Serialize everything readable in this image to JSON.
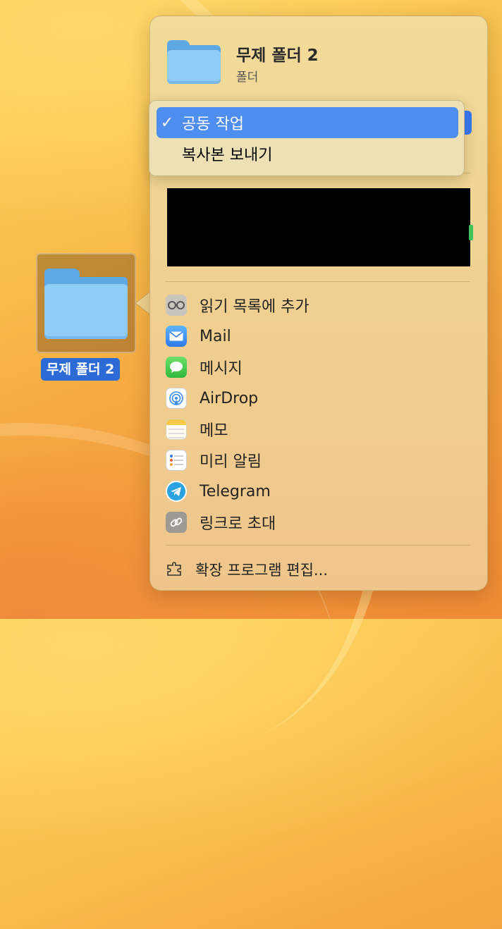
{
  "desktop": {
    "folder_name": "무제 폴더 2"
  },
  "share": {
    "title": "무제 폴더 2",
    "subtitle": "폴더",
    "dropdown": {
      "options": [
        {
          "label": "공동 작업",
          "selected": true,
          "check": "✓"
        },
        {
          "label": "복사본 보내기",
          "selected": false,
          "check": ""
        }
      ]
    },
    "items": [
      {
        "label": "읽기 목록에 추가",
        "icon": "reading-list-icon"
      },
      {
        "label": "Mail",
        "icon": "mail-icon"
      },
      {
        "label": "메시지",
        "icon": "messages-icon"
      },
      {
        "label": "AirDrop",
        "icon": "airdrop-icon"
      },
      {
        "label": "메모",
        "icon": "notes-icon"
      },
      {
        "label": "미리 알림",
        "icon": "reminders-icon"
      },
      {
        "label": "Telegram",
        "icon": "telegram-icon"
      },
      {
        "label": "링크로 초대",
        "icon": "link-icon"
      }
    ],
    "edit_extensions": "확장 프로그램 편집..."
  },
  "colors": {
    "accent": "#3478f6",
    "selection_label": "#2c6bd6",
    "folder_front": "#8fcdf7",
    "folder_back": "#5ea8e4"
  }
}
